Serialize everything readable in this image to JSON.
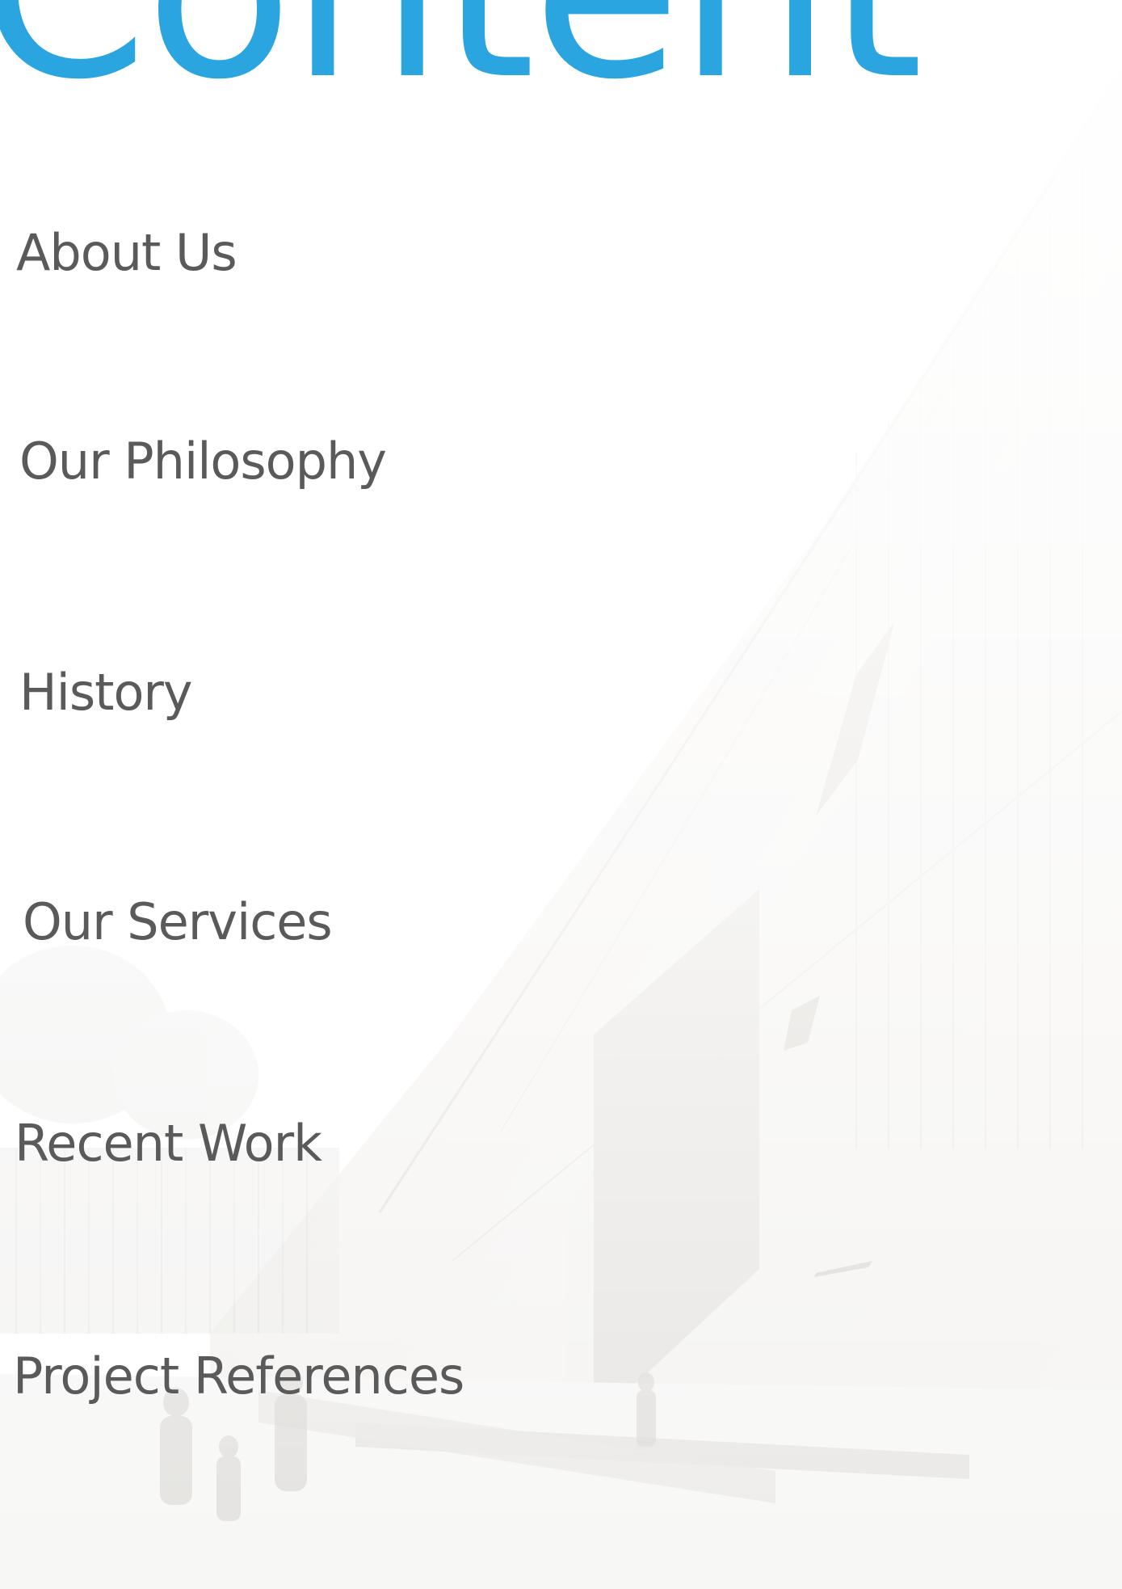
{
  "page": {
    "title": "Content",
    "accent_color": "#2aa5e0",
    "text_color": "#5a5a5a"
  },
  "toc": {
    "items": [
      {
        "label": "About Us"
      },
      {
        "label": "Our Philosophy"
      },
      {
        "label": "History"
      },
      {
        "label": "Our Services"
      },
      {
        "label": "Recent Work"
      },
      {
        "label": "Project References"
      }
    ]
  },
  "background": {
    "image": "architectural-rendering"
  }
}
